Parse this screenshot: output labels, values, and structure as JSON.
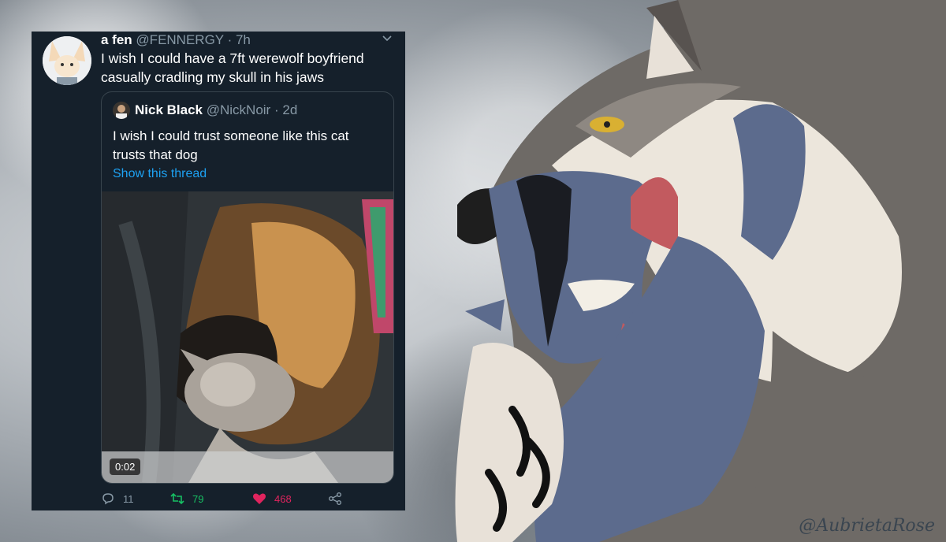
{
  "tweet": {
    "author_name": "a fen",
    "handle": "@FENNERGY",
    "time": "7h",
    "text": "I wish I could have a 7ft werewolf boyfriend casually cradling my skull in his jaws",
    "quote": {
      "author_name": "Nick Black",
      "handle": "@NickNoir",
      "time": "2d",
      "text": "I wish I could trust someone like this cat trusts that dog",
      "show_thread": "Show this thread",
      "video_duration": "0:02"
    },
    "actions": {
      "replies": "11",
      "retweets": "79",
      "likes": "468"
    },
    "colors": {
      "background": "#15202b",
      "link": "#1da1f2",
      "retweet": "#17bf63",
      "like": "#e0245e"
    }
  },
  "artwork": {
    "credit": "@AubrietaRose"
  }
}
